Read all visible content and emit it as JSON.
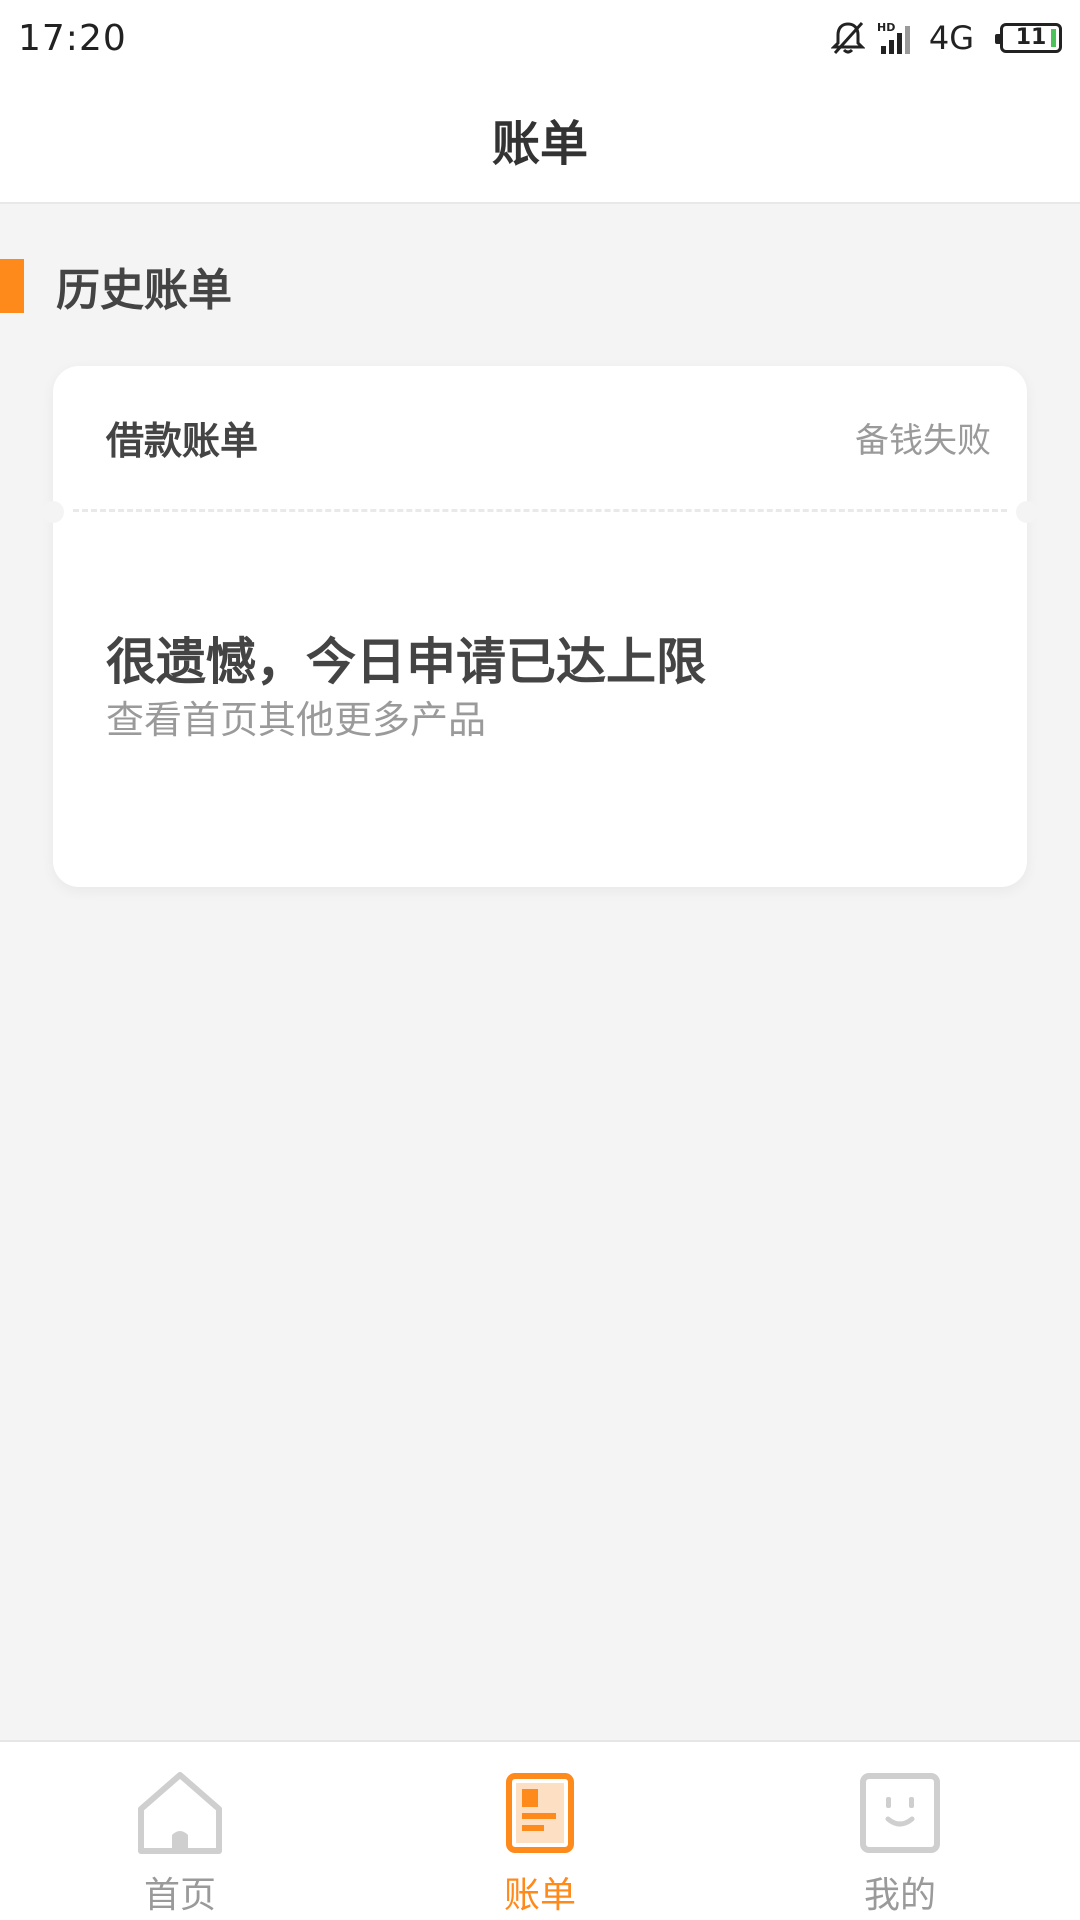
{
  "status_bar": {
    "time": "17:20",
    "network": "4G",
    "hd_label": "HD",
    "battery": "11",
    "icons": [
      "bell-muted-icon",
      "signal-icon",
      "battery-icon"
    ]
  },
  "header": {
    "title": "账单"
  },
  "section": {
    "title": "历史账单"
  },
  "bill_card": {
    "title": "借款账单",
    "status": "备钱失败",
    "message": "很遗憾，今日申请已达上限",
    "sub_message": "查看首页其他更多产品"
  },
  "tab_bar": {
    "items": [
      {
        "label": "首页",
        "icon": "home-icon",
        "active": false
      },
      {
        "label": "账单",
        "icon": "bill-icon",
        "active": true
      },
      {
        "label": "我的",
        "icon": "smiley-face-icon",
        "active": false
      }
    ]
  },
  "colors": {
    "accent": "#ff8a1c",
    "background": "#f4f4f4",
    "text_primary": "#444444",
    "text_secondary": "#9a9a9a",
    "battery_fill": "#4cc35a"
  }
}
